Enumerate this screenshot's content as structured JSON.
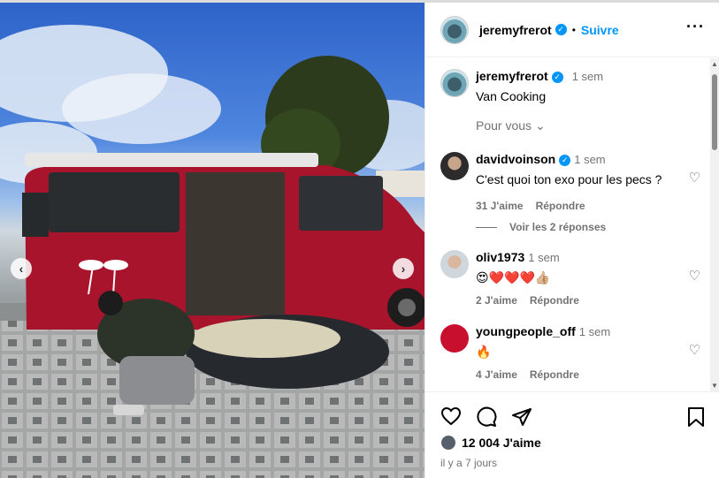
{
  "post": {
    "username": "jeremyfrerot",
    "follow_label": "Suivre",
    "caption": "Van Cooking",
    "caption_time": "1 sem",
    "for_you_label": "Pour vous",
    "likes_count": "12 004",
    "likes_label": "J'aime",
    "posted_ago": "il y a 7 jours"
  },
  "comments": [
    {
      "username": "davidvoinson",
      "verified": true,
      "time": "1 sem",
      "text": "C'est quoi ton exo pour les pecs ?",
      "likes": "31 J'aime",
      "reply_label": "Répondre",
      "view_replies": "Voir les 2 réponses"
    },
    {
      "username": "oliv1973",
      "time": "1 sem",
      "text": "😍❤️❤️❤️👍🏼",
      "likes": "2 J'aime",
      "reply_label": "Répondre"
    },
    {
      "username": "youngpeople_off",
      "time": "1 sem",
      "text": "🔥",
      "likes": "4 J'aime",
      "reply_label": "Répondre"
    }
  ],
  "icons": {
    "like": "heart-icon",
    "comment": "comment-icon",
    "share": "share-icon",
    "save": "bookmark-icon",
    "more": "more-icon"
  },
  "colors": {
    "accent": "#0095f6",
    "muted": "#737373",
    "van": "#b3162d"
  }
}
